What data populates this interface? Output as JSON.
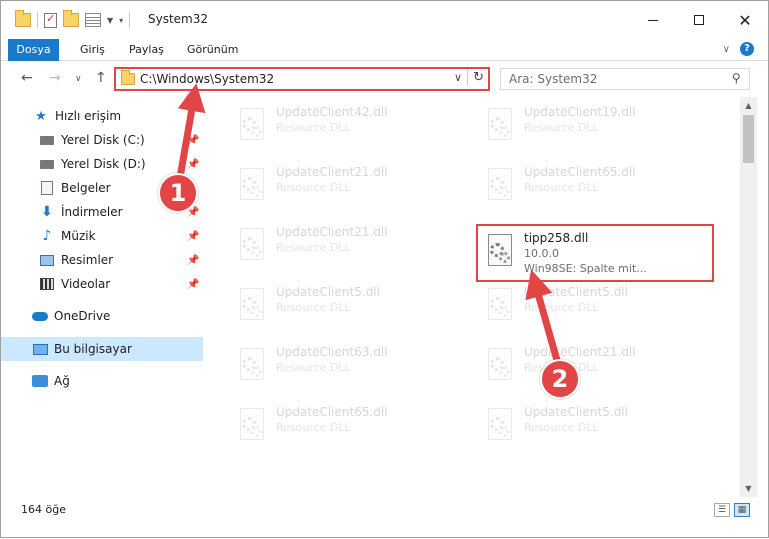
{
  "window": {
    "title": "System32"
  },
  "ribbon": {
    "tabs": [
      {
        "label": "Dosya"
      },
      {
        "label": "Giriş"
      },
      {
        "label": "Paylaş"
      },
      {
        "label": "Görünüm"
      }
    ],
    "help_label": "?"
  },
  "nav": {
    "address": "C:\\Windows\\System32",
    "search_placeholder": "Ara: System32"
  },
  "sidebar": {
    "quick_access": "Hızlı erişim",
    "items": [
      {
        "label": "Yerel Disk (C:)",
        "icon": "local-disk-c-icon"
      },
      {
        "label": "Yerel Disk (D:)",
        "icon": "local-disk-d-icon"
      },
      {
        "label": "Belgeler",
        "icon": "documents-icon"
      },
      {
        "label": "İndirmeler",
        "icon": "downloads-icon"
      },
      {
        "label": "Müzik",
        "icon": "music-icon"
      },
      {
        "label": "Resimler",
        "icon": "pictures-icon"
      },
      {
        "label": "Videolar",
        "icon": "videos-icon"
      }
    ],
    "onedrive": "OneDrive",
    "this_pc": "Bu bilgisayar",
    "network": "Ağ"
  },
  "files": {
    "left": [
      {
        "name": "UpdateClient42.dll",
        "type": "Resource DLL"
      },
      {
        "name": "UpdateClient21.dll",
        "type": "Resource DLL"
      },
      {
        "name": "UpdateClient21.dll",
        "type": "Resource DLL"
      },
      {
        "name": "UpdateClient5.dll",
        "type": "Resource DLL"
      },
      {
        "name": "UpdateClient63.dll",
        "type": "Resource DLL"
      },
      {
        "name": "UpdateClient65.dll",
        "type": "Resource DLL"
      }
    ],
    "right": [
      {
        "name": "UpdateClient19.dll",
        "type": "Resource DLL"
      },
      {
        "name": "UpdateClient65.dll",
        "type": "Resource DLL"
      },
      {
        "name": "UpdateClient5.dll",
        "type": "Resource DLL"
      },
      {
        "name": "UpdateClient21.dll",
        "type": "Resource DLL"
      },
      {
        "name": "UpdateClient5.dll",
        "type": "Resource DLL"
      }
    ],
    "highlighted": {
      "name": "tipp258.dll",
      "version": "10.0.0",
      "description": "Win98SE: Spalte mit..."
    }
  },
  "status": {
    "count": "164 öğe"
  },
  "annotations": {
    "badge1": "1",
    "badge2": "2",
    "color": "#e24545"
  }
}
